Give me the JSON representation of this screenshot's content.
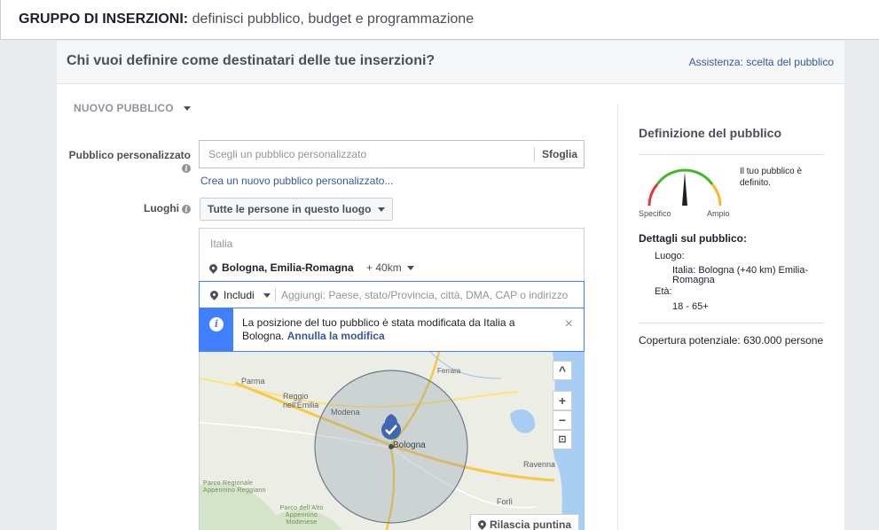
{
  "header": {
    "title_bold": "GRUPPO DI INSERZIONI:",
    "title_rest": " definisci pubblico, budget e programmazione"
  },
  "section": {
    "title": "Chi vuoi definire come destinatari delle tue inserzioni?",
    "help_link": "Assistenza: scelta del pubblico"
  },
  "audience_selector": {
    "label": "NUOVO PUBBLICO"
  },
  "custom_audience": {
    "label": "Pubblico personalizzato",
    "placeholder": "Scegli un pubblico personalizzato",
    "browse_label": "Sfoglia",
    "create_link": "Crea un nuovo pubblico personalizzato..."
  },
  "locations": {
    "label": "Luoghi",
    "mode": "Tutte le persone in questo luogo",
    "country": "Italia",
    "city": "Bologna, Emilia-Romagna",
    "radius": "+ 40km",
    "include_label": "Includi",
    "add_placeholder": "Aggiungi: Paese, stato/Provincia, città, DMA, CAP o indirizzo"
  },
  "notice": {
    "text": "La posizione del tuo pubblico è stata modificata da Italia a Bologna.",
    "link": "Annulla la modifica"
  },
  "map": {
    "labels": {
      "parma": "Parma",
      "reggio": "Reggio nell'Emilia",
      "modena": "Modena",
      "bologna": "Bologna",
      "ferrara": "Ferrara",
      "ravenna": "Ravenna",
      "forli": "Forlì",
      "parco1": "Parco Regionale Appennino Reggiano",
      "parco2": "Parco dell'Alto Appennino Modenese"
    },
    "zoom_in": "+",
    "zoom_out": "−",
    "collapse": "^",
    "release_pin": "Rilascia puntina"
  },
  "audience_definition": {
    "title": "Definizione del pubblico",
    "gauge_left": "Specifico",
    "gauge_right": "Ampio",
    "status": "Il tuo pubblico è definito.",
    "details_title": "Dettagli sul pubblico:",
    "location_label": "Luogo:",
    "location_value": "Italia: Bologna (+40 km) Emilia-Romagna",
    "age_label": "Età:",
    "age_value": "18 - 65+",
    "coverage": "Copertura potenziale: 630.000 persone"
  },
  "colors": {
    "link": "#365899",
    "accent": "#4080ff",
    "gauge_red": "#e0393e",
    "gauge_yellow": "#f7b928",
    "gauge_green": "#42b72a"
  }
}
